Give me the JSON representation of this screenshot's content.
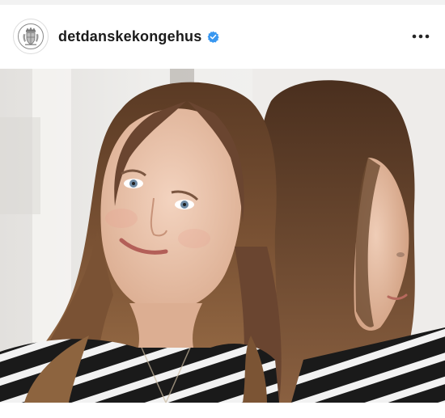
{
  "post": {
    "username": "detdanskekongehus",
    "verified": true,
    "avatar_icon": "royal-crest-icon",
    "more_icon": "more-horizontal-icon",
    "verified_icon": "verified-badge-icon",
    "verified_color": "#3897f0",
    "media": {
      "type": "photo",
      "subject": "girl-with-mirror-reflection"
    }
  }
}
